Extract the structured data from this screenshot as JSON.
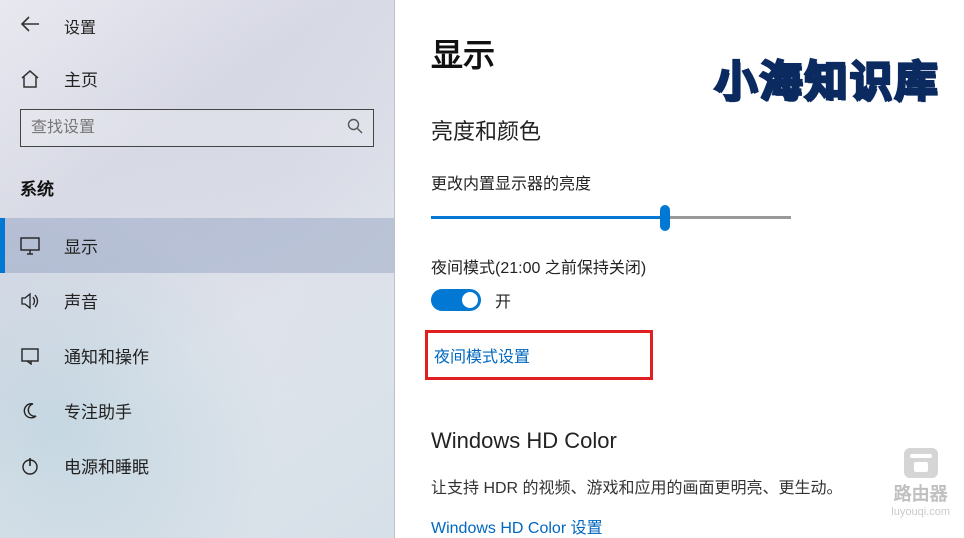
{
  "header": {
    "title": "设置"
  },
  "home": {
    "label": "主页"
  },
  "search": {
    "placeholder": "查找设置"
  },
  "category": "系统",
  "nav": [
    {
      "label": "显示",
      "icon": "monitor"
    },
    {
      "label": "声音",
      "icon": "sound"
    },
    {
      "label": "通知和操作",
      "icon": "notification"
    },
    {
      "label": "专注助手",
      "icon": "moon"
    },
    {
      "label": "电源和睡眠",
      "icon": "power"
    }
  ],
  "page": {
    "title": "显示",
    "section1": "亮度和颜色",
    "brightness_label": "更改内置显示器的亮度",
    "brightness_value": 65,
    "night_label": "夜间模式(21:00 之前保持关闭)",
    "toggle_state": "开",
    "night_settings_link": "夜间模式设置",
    "section2": "Windows HD Color",
    "hd_desc": "让支持 HDR 的视频、游戏和应用的画面更明亮、更生动。",
    "hd_link": "Windows HD Color 设置"
  },
  "watermark": {
    "title": "小海知识库",
    "corner_main": "路由器",
    "corner_sub": "luyouqi.com"
  }
}
